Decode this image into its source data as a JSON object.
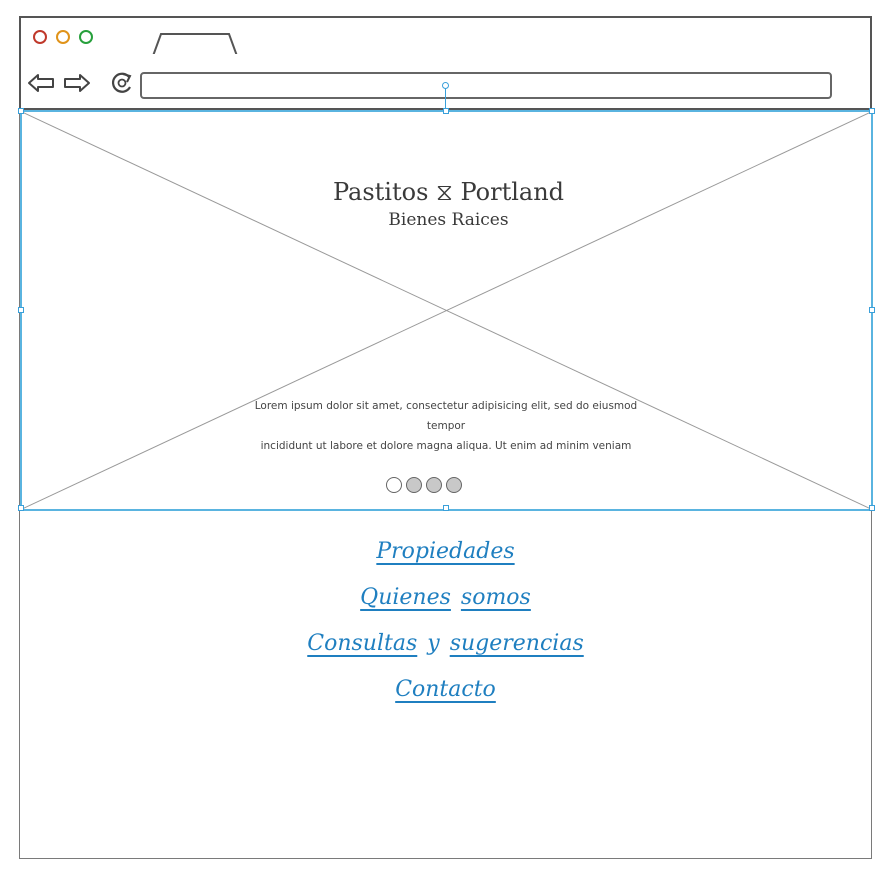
{
  "browser": {
    "window_controls": [
      "close",
      "minimize",
      "maximize"
    ],
    "address_value": ""
  },
  "hero": {
    "title": "Pastitos ⧖ Portland",
    "subtitle": "Bienes Raices",
    "body_line1": "Lorem ipsum dolor sit amet, consectetur adipisicing elit, sed do eiusmod tempor",
    "body_line2": "incididunt ut labore et dolore magna aliqua. Ut enim ad minim veniam",
    "carousel": {
      "count": 4,
      "active_index": 0
    }
  },
  "nav_links": {
    "propiedades": "Propiedades",
    "quienes": "Quienes",
    "somos": "somos",
    "consultas": "Consultas",
    "y": "y",
    "sugerencias": "sugerencias",
    "contacto": "Contacto"
  },
  "colors": {
    "link": "#1f7fc0",
    "selection": "#5ab4e0",
    "close": "#c0392b",
    "minimize": "#e0931a",
    "maximize": "#27a03c"
  },
  "icons": [
    "back-arrow-icon",
    "forward-arrow-icon",
    "reload-icon",
    "hourglass-icon"
  ]
}
